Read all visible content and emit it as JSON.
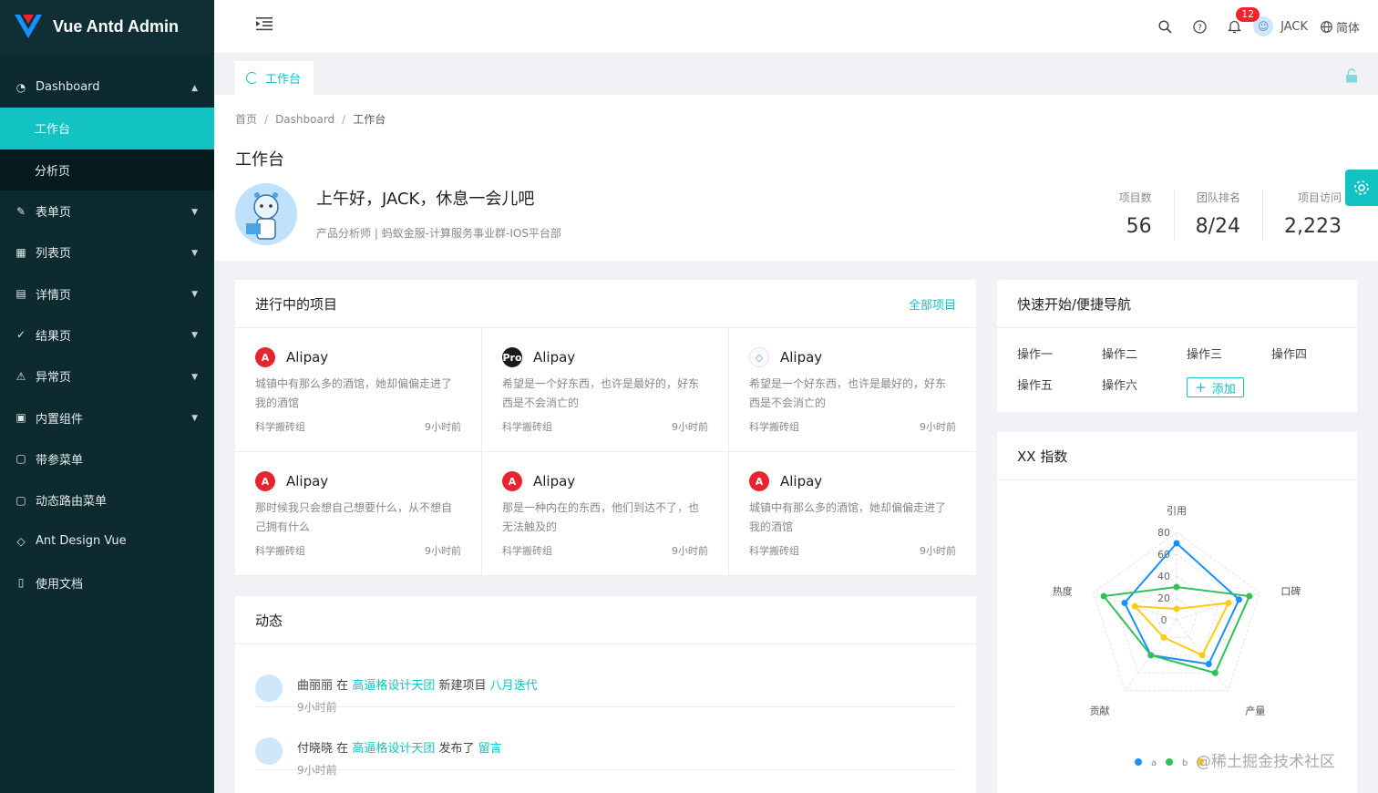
{
  "app": {
    "title": "Vue Antd Admin"
  },
  "sidebar": {
    "items": [
      {
        "label": "Dashboard",
        "icon": "dashboard-icon"
      },
      {
        "label": "工作台"
      },
      {
        "label": "分析页"
      },
      {
        "label": "表单页",
        "icon": "form-icon"
      },
      {
        "label": "列表页",
        "icon": "table-icon"
      },
      {
        "label": "详情页",
        "icon": "profile-icon"
      },
      {
        "label": "结果页",
        "icon": "check-circle-icon"
      },
      {
        "label": "异常页",
        "icon": "warning-icon"
      },
      {
        "label": "内置组件",
        "icon": "appstore-icon"
      },
      {
        "label": "带参菜单",
        "icon": "file-icon"
      },
      {
        "label": "动态路由菜单",
        "icon": "file-icon"
      },
      {
        "label": "Ant Design Vue",
        "icon": "ant-design-icon"
      },
      {
        "label": "使用文档",
        "icon": "doc-icon"
      }
    ]
  },
  "header": {
    "notifications": "12",
    "user": "JACK",
    "language": "简体"
  },
  "tabs": [
    {
      "label": "工作台"
    }
  ],
  "breadcrumb": [
    "首页",
    "Dashboard",
    "工作台"
  ],
  "page": {
    "title": "工作台",
    "greeting": "上午好，JACK，休息一会儿吧",
    "description": "产品分析师 | 蚂蚁金服-计算服务事业群-IOS平台部",
    "stats": [
      {
        "label": "项目数",
        "value": "56"
      },
      {
        "label": "团队排名",
        "value": "8/24"
      },
      {
        "label": "项目访问",
        "value": "2,223"
      }
    ]
  },
  "projects": {
    "title": "进行中的项目",
    "all_link": "全部项目",
    "items": [
      {
        "name": "Alipay",
        "logo": "A",
        "color": "#e8252e",
        "desc": "城镇中有那么多的酒馆，她却偏偏走进了我的酒馆",
        "team": "科学搬砖组",
        "time": "9小时前"
      },
      {
        "name": "Alipay",
        "logo": "Pro",
        "color": "#1a1a1a",
        "desc": "希望是一个好东西，也许是最好的，好东西是不会消亡的",
        "team": "科学搬砖组",
        "time": "9小时前"
      },
      {
        "name": "Alipay",
        "logo": "◇",
        "color": "#ffffff",
        "desc": "希望是一个好东西，也许是最好的，好东西是不会消亡的",
        "team": "科学搬砖组",
        "time": "9小时前"
      },
      {
        "name": "Alipay",
        "logo": "A",
        "color": "#e8252e",
        "desc": "那时候我只会想自己想要什么，从不想自己拥有什么",
        "team": "科学搬砖组",
        "time": "9小时前"
      },
      {
        "name": "Alipay",
        "logo": "A",
        "color": "#e8252e",
        "desc": "那是一种内在的东西，他们到达不了，也无法触及的",
        "team": "科学搬砖组",
        "time": "9小时前"
      },
      {
        "name": "Alipay",
        "logo": "A",
        "color": "#e8252e",
        "desc": "城镇中有那么多的酒馆，她却偏偏走进了我的酒馆",
        "team": "科学搬砖组",
        "time": "9小时前"
      }
    ]
  },
  "activity": {
    "title": "动态",
    "items": [
      {
        "user": "曲丽丽",
        "t1": "在",
        "group": "高逼格设计天团",
        "t2": "新建项目",
        "target": "八月迭代",
        "time": "9小时前"
      },
      {
        "user": "付晓晓",
        "t1": "在",
        "group": "高逼格设计天团",
        "t2": "发布了",
        "target": "留言",
        "time": "9小时前"
      }
    ]
  },
  "quick": {
    "title": "快速开始/便捷导航",
    "items": [
      "操作一",
      "操作二",
      "操作三",
      "操作四",
      "操作五",
      "操作六"
    ],
    "add_label": "添加"
  },
  "radar": {
    "title": "XX 指数",
    "watermark": "@稀土掘金技术社区"
  },
  "chart_data": {
    "type": "radar",
    "title": "XX 指数",
    "categories": [
      "引用",
      "口碑",
      "产量",
      "贡献",
      "热度"
    ],
    "ticks": [
      "0",
      "20",
      "40",
      "60",
      "80"
    ],
    "range": [
      0,
      80
    ],
    "series": [
      {
        "name": "a",
        "color": "#1890ff",
        "values": [
          70,
          60,
          50,
          40,
          50
        ]
      },
      {
        "name": "b",
        "color": "#2fc25b",
        "values": [
          30,
          70,
          60,
          40,
          70
        ]
      },
      {
        "name": "c",
        "color": "#facc14",
        "values": [
          10,
          50,
          40,
          20,
          40
        ]
      }
    ],
    "legend_labels": [
      "a",
      "b"
    ],
    "legend_position": "bottom-right"
  }
}
